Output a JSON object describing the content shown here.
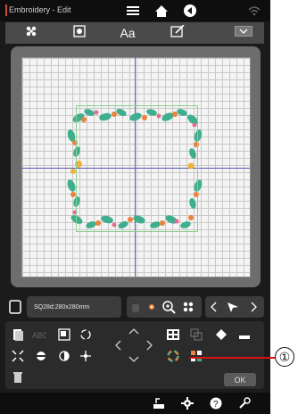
{
  "app": {
    "title": "Embroidery - Edit"
  },
  "tabs": [
    {
      "icon": "stitch-icon"
    },
    {
      "icon": "pattern-icon"
    },
    {
      "label": "Aa",
      "icon": "text-icon"
    },
    {
      "icon": "edit-icon"
    },
    {
      "icon": "collapse-icon"
    }
  ],
  "design": {
    "name": "SQ28d:280x280mm"
  },
  "panel": {
    "ok_label": "OK"
  },
  "callout": {
    "number": "①"
  },
  "colors": {
    "accent": "#d04a3a",
    "leaf": "#3fae8e",
    "flower": "#e8823c",
    "grid": "#c9c9c9",
    "axis": "#5a5ab0"
  }
}
